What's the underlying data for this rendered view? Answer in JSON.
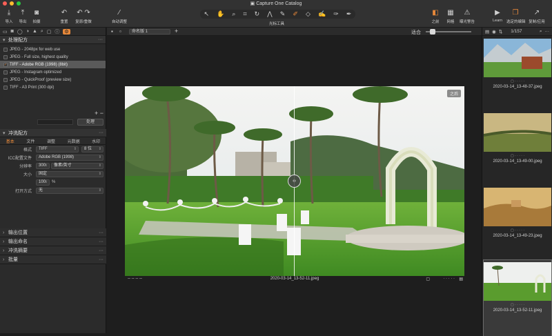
{
  "window": {
    "title": "Capture One Catalog"
  },
  "toolbar": {
    "import": "导入",
    "export": "导出",
    "capture": "拍摄",
    "reset": "重置",
    "undo_redo": "复原/重做",
    "auto_adjust": "自动调整",
    "cursor_tools": "光标工具",
    "before": "之前",
    "grid": "网格",
    "exposure_warning": "曝光警告",
    "learn": "Learn",
    "selected_edits": "选定的编辑",
    "copy_apply": "复制/应用"
  },
  "left_panel": {
    "process_recipes": {
      "title": "处理配方",
      "items": [
        {
          "label": "JPEG - 2048px for web use",
          "checked": false
        },
        {
          "label": "JPEG - Full size, highest quality",
          "checked": false
        },
        {
          "label": "TIFF - Adobe RGB (1998) (8bit)",
          "checked": true
        },
        {
          "label": "JPEG - Instagram optimized",
          "checked": false
        },
        {
          "label": "JPEG - QuickProof (preview size)",
          "checked": false
        },
        {
          "label": "TIFF - A3 Print (300 dpi)",
          "checked": false
        }
      ],
      "process_button": "处理"
    },
    "process_recipe": {
      "title": "冲洗配方",
      "tabs": [
        "基本",
        "文件",
        "调整",
        "元数据",
        "水印"
      ],
      "format_label": "格式",
      "format_value": "TIFF",
      "bit_value": "8 位",
      "icc_label": "ICC配置文件",
      "icc_value": "Adobe RGB (1998)",
      "resolution_label": "分辨率",
      "resolution_value": "300",
      "resolution_unit": "像素/英寸",
      "size_label": "大小",
      "size_value": "固定",
      "scale_value": "100",
      "scale_unit": "%",
      "open_with_label": "打开方式",
      "open_with_value": "无"
    },
    "collapsed_sections": [
      "输出位置",
      "输出命名",
      "冲洗摘要",
      "批量"
    ]
  },
  "viewer": {
    "variant": "命名版 1",
    "fit": "适合",
    "after_badge": "之后",
    "filename": "2020-03-14_13-52-11.jpeg",
    "left_meta": "--  --  --  --"
  },
  "browser": {
    "count": "1/157",
    "thumbnails": [
      {
        "name": "2020-03-14_13-48-37.jpeg"
      },
      {
        "name": "2020-03-14_13-49-00.jpeg"
      },
      {
        "name": "2020-03-14_13-49-23.jpeg"
      },
      {
        "name": "2020-03-14_13-52-11.jpeg"
      }
    ]
  },
  "colors": {
    "accent": "#e8893a",
    "panel": "#2b2b2b",
    "toolbar": "#323232",
    "viewer": "#1e1e1e"
  }
}
